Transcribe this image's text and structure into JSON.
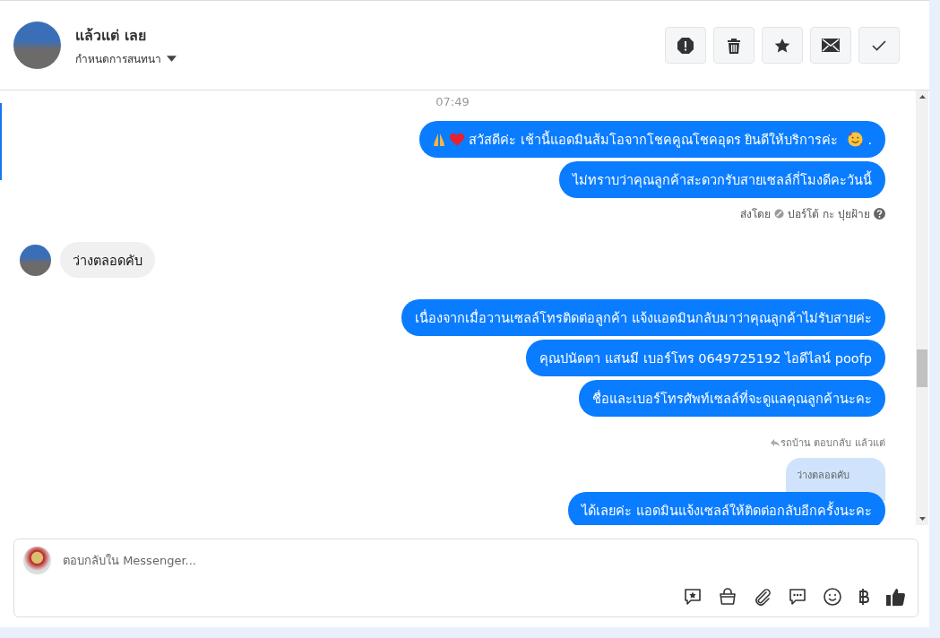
{
  "header": {
    "name": "แล้วแต่ เลย",
    "subtitle": "กำหนดการสนทนา"
  },
  "thread": [
    {
      "kind": "time",
      "text": "07:49"
    },
    {
      "kind": "out",
      "text": "สวัสดีค่ะ เช้านี้แอดมินส้มโอจากโชคคูณโชคอุดร ยินดีให้บริการค่ะ",
      "lead_emoji": true,
      "tail_emoji": true,
      "tail": "."
    },
    {
      "kind": "out",
      "text": "ไม่ทราบว่าคุณลูกค้าสะดวกรับสายเซลล์กี่โมงดีคะวันนี้"
    },
    {
      "kind": "meta",
      "label": "ส่งโดย",
      "sender": "ปอร์โต้ กะ ปุยฝ้าย"
    },
    {
      "kind": "in",
      "text": "ว่างตลอดคับ"
    },
    {
      "kind": "out",
      "text": "เนื่องจากเมื่อวานเซลล์โทรติดต่อลูกค้า แจ้งแอดมินกลับมาว่าคุณลูกค้าไม่รับสายค่ะ"
    },
    {
      "kind": "out",
      "text": "คุณปนัดดา แสนมี   เบอร์โทร 0649725192  ไอดีไลน์ poofp"
    },
    {
      "kind": "out",
      "text": "ชื่อและเบอร์โทรศัพท์เซลล์ที่จะดูแลคุณลูกค้านะคะ"
    },
    {
      "kind": "reply_label",
      "text": "รถบ้าน ตอบกลับ แล้วแต่"
    },
    {
      "kind": "quote",
      "text": "ว่างตลอดคับ"
    },
    {
      "kind": "out",
      "text": "ได้เลยค่ะ แอดมินแจ้งเซลล์ให้ติดต่อกลับอีกครั้งนะคะ"
    }
  ],
  "composer": {
    "placeholder": "ตอบกลับใน Messenger..."
  }
}
